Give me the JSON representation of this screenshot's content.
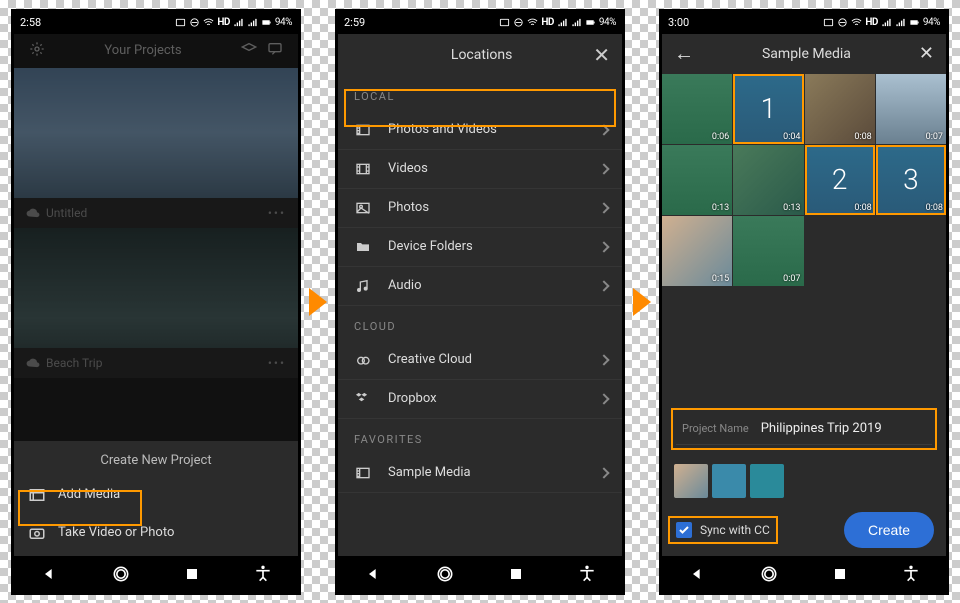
{
  "statusbar": {
    "time1": "2:58",
    "time2": "2:59",
    "time3": "3:00",
    "hd": "HD",
    "battery": "94%"
  },
  "phone1": {
    "header_title": "Your Projects",
    "project1": "Untitled",
    "project2": "Beach Trip",
    "dots": "•••",
    "sheet_title": "Create New Project",
    "add_media": "Add Media",
    "take_video": "Take Video or Photo"
  },
  "phone2": {
    "title": "Locations",
    "section_local": "LOCAL",
    "section_cloud": "CLOUD",
    "section_favorites": "FAVORITES",
    "items": {
      "photos_videos": "Photos and Videos",
      "videos": "Videos",
      "photos": "Photos",
      "device_folders": "Device Folders",
      "audio": "Audio",
      "creative_cloud": "Creative Cloud",
      "dropbox": "Dropbox",
      "sample_media": "Sample Media"
    }
  },
  "phone3": {
    "title": "Sample Media",
    "badge1": "1",
    "badge2": "2",
    "badge3": "3",
    "dur": {
      "t1": "0:06",
      "t2": "0:04",
      "t3": "0:08",
      "t4": "0:07",
      "t5": "0:13",
      "t6": "0:13",
      "t7": "0:08",
      "t8": "0:08",
      "t9": "0:15",
      "t10": "0:07"
    },
    "project_name_label": "Project Name",
    "project_name_value": "Philippines Trip 2019",
    "sync_label": "Sync with CC",
    "create_label": "Create"
  }
}
